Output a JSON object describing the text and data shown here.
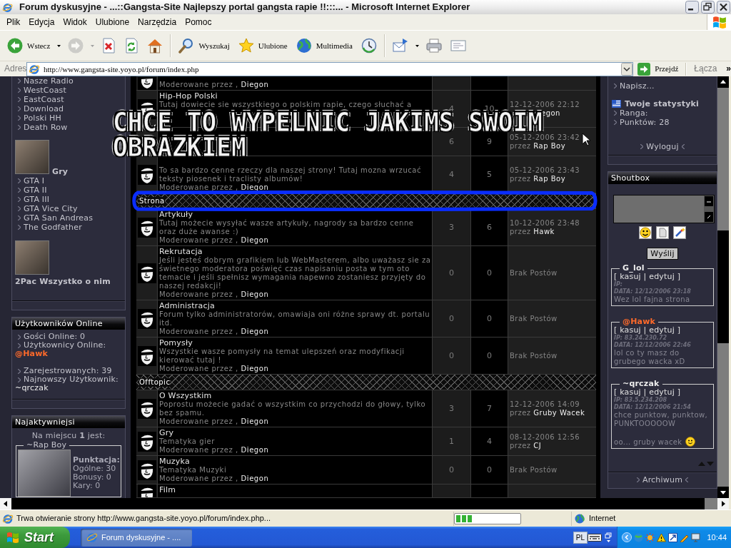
{
  "window": {
    "title": "Forum dyskusyjne - ...::Gangsta-Site Najlepszy portal gangsta rapie !!:::... - Microsoft Internet Explorer"
  },
  "menu": [
    {
      "label": "Plik"
    },
    {
      "label": "Edycja"
    },
    {
      "label": "Widok"
    },
    {
      "label": "Ulubione"
    },
    {
      "label": "Narzędzia"
    },
    {
      "label": "Pomoc"
    }
  ],
  "toolbar": [
    {
      "kind": "back",
      "label": "Wstecz",
      "dropdown": true,
      "disabled": false
    },
    {
      "kind": "forward",
      "dropdown": true,
      "disabled": true
    },
    {
      "kind": "stop",
      "dropdown": false,
      "disabled": false
    },
    {
      "kind": "refresh",
      "dropdown": false,
      "disabled": false
    },
    {
      "kind": "home",
      "dropdown": false,
      "disabled": false
    },
    {
      "kind": "search",
      "label": "Wyszukaj",
      "dropdown": false,
      "disabled": false
    },
    {
      "kind": "favorites",
      "label": "Ulubione",
      "dropdown": false,
      "disabled": false
    },
    {
      "kind": "media",
      "label": "Multimedia",
      "dropdown": false,
      "disabled": false
    },
    {
      "kind": "history",
      "dropdown": false,
      "disabled": false
    },
    {
      "kind": "mail",
      "dropdown": true,
      "disabled": false
    },
    {
      "kind": "print",
      "dropdown": false,
      "disabled": false
    },
    {
      "kind": "edit",
      "dropdown": false,
      "disabled": false
    }
  ],
  "address_bar": {
    "label": "Adres",
    "url": "http://www.gangsta-site.yoyo.pl/forum/index.php",
    "go": "Przejdź",
    "links": "Łącza",
    "more": "»"
  },
  "left_sidebar": {
    "links": [
      "Nasze Radio",
      "WestCoast",
      "EastCoast",
      "Download",
      "Polski HH",
      "Death Row"
    ],
    "sections": [
      {
        "heading": "Gry",
        "links": [
          "GTA I",
          "GTA II",
          "GTA III",
          "GTA Vice City",
          "GTA San Andreas",
          "The Godfather"
        ]
      },
      {
        "heading": "2Pac Wszystko o nim"
      }
    ],
    "online": {
      "title": "Użytkowników Online",
      "guests": "Gości Online: 0",
      "users_label": "Użytkownicy Online:",
      "users": [
        {
          "name": "@Hawk",
          "kind": "admin"
        }
      ],
      "registered": "Zarejestrowanych: 39",
      "newest_label": "Najnowszy Użytkownik:",
      "newest": {
        "name": "~qrczak",
        "kind": "user"
      }
    },
    "most_active": {
      "title": "Najaktywniejsi",
      "intro": "Na miejscu **1** jest:",
      "user": "~Rap Boy",
      "score_heading": "Punktacja:",
      "scores": [
        "Ogólne: 30",
        "Bonusy: 0",
        "Kary: 0"
      ]
    }
  },
  "forum": {
    "rows": [
      {
        "kind": "forum",
        "moderator_label": "Moderowane przez ,",
        "moderator": "Diegon"
      },
      {
        "kind": "forum",
        "title": "Hip-Hop Polski",
        "description": "Tutaj dowiecie sie wszystkiego o polskim rapie, czego słuchać a",
        "description_hidden": true,
        "moderator_hidden": true,
        "topics": "4",
        "posts": "10",
        "last_post": {
          "date": "12-12-2006 22:12",
          "author": "egon",
          "prefix_hidden": true
        }
      },
      {
        "kind": "forum",
        "icon_hidden": true,
        "title_hidden": true,
        "description_hidden": true,
        "moderator_hidden": true,
        "topics": "6",
        "posts": "9",
        "last_post": {
          "date": "05-12-2006 23:42",
          "prefix": "przez",
          "author": "Rap Boy"
        }
      },
      {
        "kind": "forum",
        "title_hidden": true,
        "description": "To sa bardzo cenne rzeczy dla naszej strony! Tutaj mozna wrzucać teksty piosenek i traclisty albumów!",
        "moderator_label": "Moderowane przez ,",
        "moderator": "Diegon",
        "topics": "4",
        "posts": "5",
        "last_post": {
          "date": "05-12-2006 23:43",
          "prefix": "przez",
          "author": "Rap Boy"
        }
      },
      {
        "kind": "category",
        "title": "Strona",
        "highlighted": true
      },
      {
        "kind": "forum",
        "title": "Artykuły",
        "description": "Tutaj możecie wysyłać wasze artykuły, nagrody sa bardzo cenne oraz duże awanse :)",
        "moderator_label": "Moderowane przez ,",
        "moderator": "Diegon",
        "topics": "3",
        "posts": "6",
        "last_post": {
          "date": "10-12-2006 23:48",
          "prefix": "przez",
          "author": "Hawk"
        }
      },
      {
        "kind": "forum",
        "title": "Rekrutacja",
        "description": "Jeśli jesteś dobrym grafikiem lub WebMasterem, albo uważasz sie za świetnego moderatora poświęć czas napisaniu posta w tym oto temacie i jeśli spełnisz wymagania napewno zostaniesz przyjęty do naszej redakcji!",
        "moderator_label": "Moderowane przez ,",
        "moderator": "Diegon",
        "topics": "0",
        "posts": "0",
        "last_post": {
          "empty": "Brak Postów"
        }
      },
      {
        "kind": "forum",
        "title": "Administracja",
        "description": "Forum tylko administratorów, omawiaja oni różne sprawy dt. portalu itd.",
        "moderator_label": "Moderowane przez ,",
        "moderator": "Diegon",
        "topics": "0",
        "posts": "0",
        "last_post": {
          "empty": "Brak Postów"
        }
      },
      {
        "kind": "forum",
        "title": "Pomysły",
        "description": "Wszystkie wasze pomysły na temat ulepszeń oraz modyfikacji kierować tutaj !",
        "moderator_label": "Moderowane przez ,",
        "moderator": "Diegon",
        "topics": "0",
        "posts": "0",
        "last_post": {
          "empty": "Brak Postów"
        }
      },
      {
        "kind": "category",
        "title": "Offtopic",
        "highlighted": false
      },
      {
        "kind": "forum",
        "title": "O Wszystkim",
        "description": "Poprostu możecie gadać o wszystkim co przychodzi do głowy, tylko bez spamu.",
        "moderator_label": "Moderowane przez ,",
        "moderator": "Diegon",
        "topics": "3",
        "posts": "7",
        "last_post": {
          "date": "12-12-2006 14:09",
          "prefix": "przez",
          "author": "Gruby Wacek"
        }
      },
      {
        "kind": "forum",
        "title": "Gry",
        "description": "Tematyka gier",
        "moderator_label": "Moderowane przez ,",
        "moderator": "Diegon",
        "topics": "1",
        "posts": "4",
        "last_post": {
          "date": "08-12-2006 12:56",
          "prefix": "przez",
          "author": "CJ"
        }
      },
      {
        "kind": "forum",
        "title": "Muzyka",
        "description": "Tematyka Muzyki",
        "moderator_label": "Moderowane przez ,",
        "moderator": "Diegon",
        "topics": "0",
        "posts": "0",
        "last_post": {
          "empty": "Brak Postów"
        }
      },
      {
        "kind": "forum",
        "title": "Film"
      }
    ]
  },
  "annotation": {
    "lines": [
      "CHCE TO WYPELNIC JAKIMS SWOIM",
      "OBRAZKIEM"
    ]
  },
  "right_sidebar": {
    "user_panel": {
      "links": [
        "Napisz..."
      ],
      "stats_title": "Twoje statystyki",
      "stats": [
        "Ranga:",
        "Punktów: 28"
      ],
      "logout": "Wyloguj"
    },
    "shoutbox": {
      "title": "Shoutbox",
      "send": "Wyślij",
      "shouts": [
        {
          "author": "G_lol",
          "kind": "user",
          "actions": "[ kasuj | edytuj ]",
          "ip": "IP:",
          "date": "DATA: 12/12/2006 23:18",
          "message": [
            "Wez lol fajna strona"
          ],
          "smiley": false
        },
        {
          "author": "@Hawk",
          "kind": "admin",
          "actions": "[ kasuj | edytuj ]",
          "ip": "IP: 83.24.230.72",
          "date": "DATA: 12/12/2006 22:46",
          "message": [
            "lol co ty masz do grubego wacka xD"
          ],
          "smiley": false
        },
        {
          "author": "~qrczak",
          "kind": "user",
          "actions": "[ kasuj | edytuj ]",
          "ip": "IP: 83.5.234.208",
          "date": "DATA: 12/12/2006 21:54",
          "message": [
            "chce punktow, punktow, PUNKTOOOOOW",
            "oo... gruby wacek"
          ],
          "smiley": true
        }
      ],
      "archive": "Archiwum"
    }
  },
  "status_bar": {
    "text": "Trwa otwieranie strony http://www.gangsta-site.yoyo.pl/forum/index.php...",
    "progress": {
      "level": 0.25
    },
    "zone": "Internet"
  },
  "taskbar": {
    "start": "Start",
    "tasks": [
      {
        "label": "Forum dyskusyjne - ....",
        "selected": true
      }
    ],
    "language": "PL",
    "clock": "10:44"
  }
}
